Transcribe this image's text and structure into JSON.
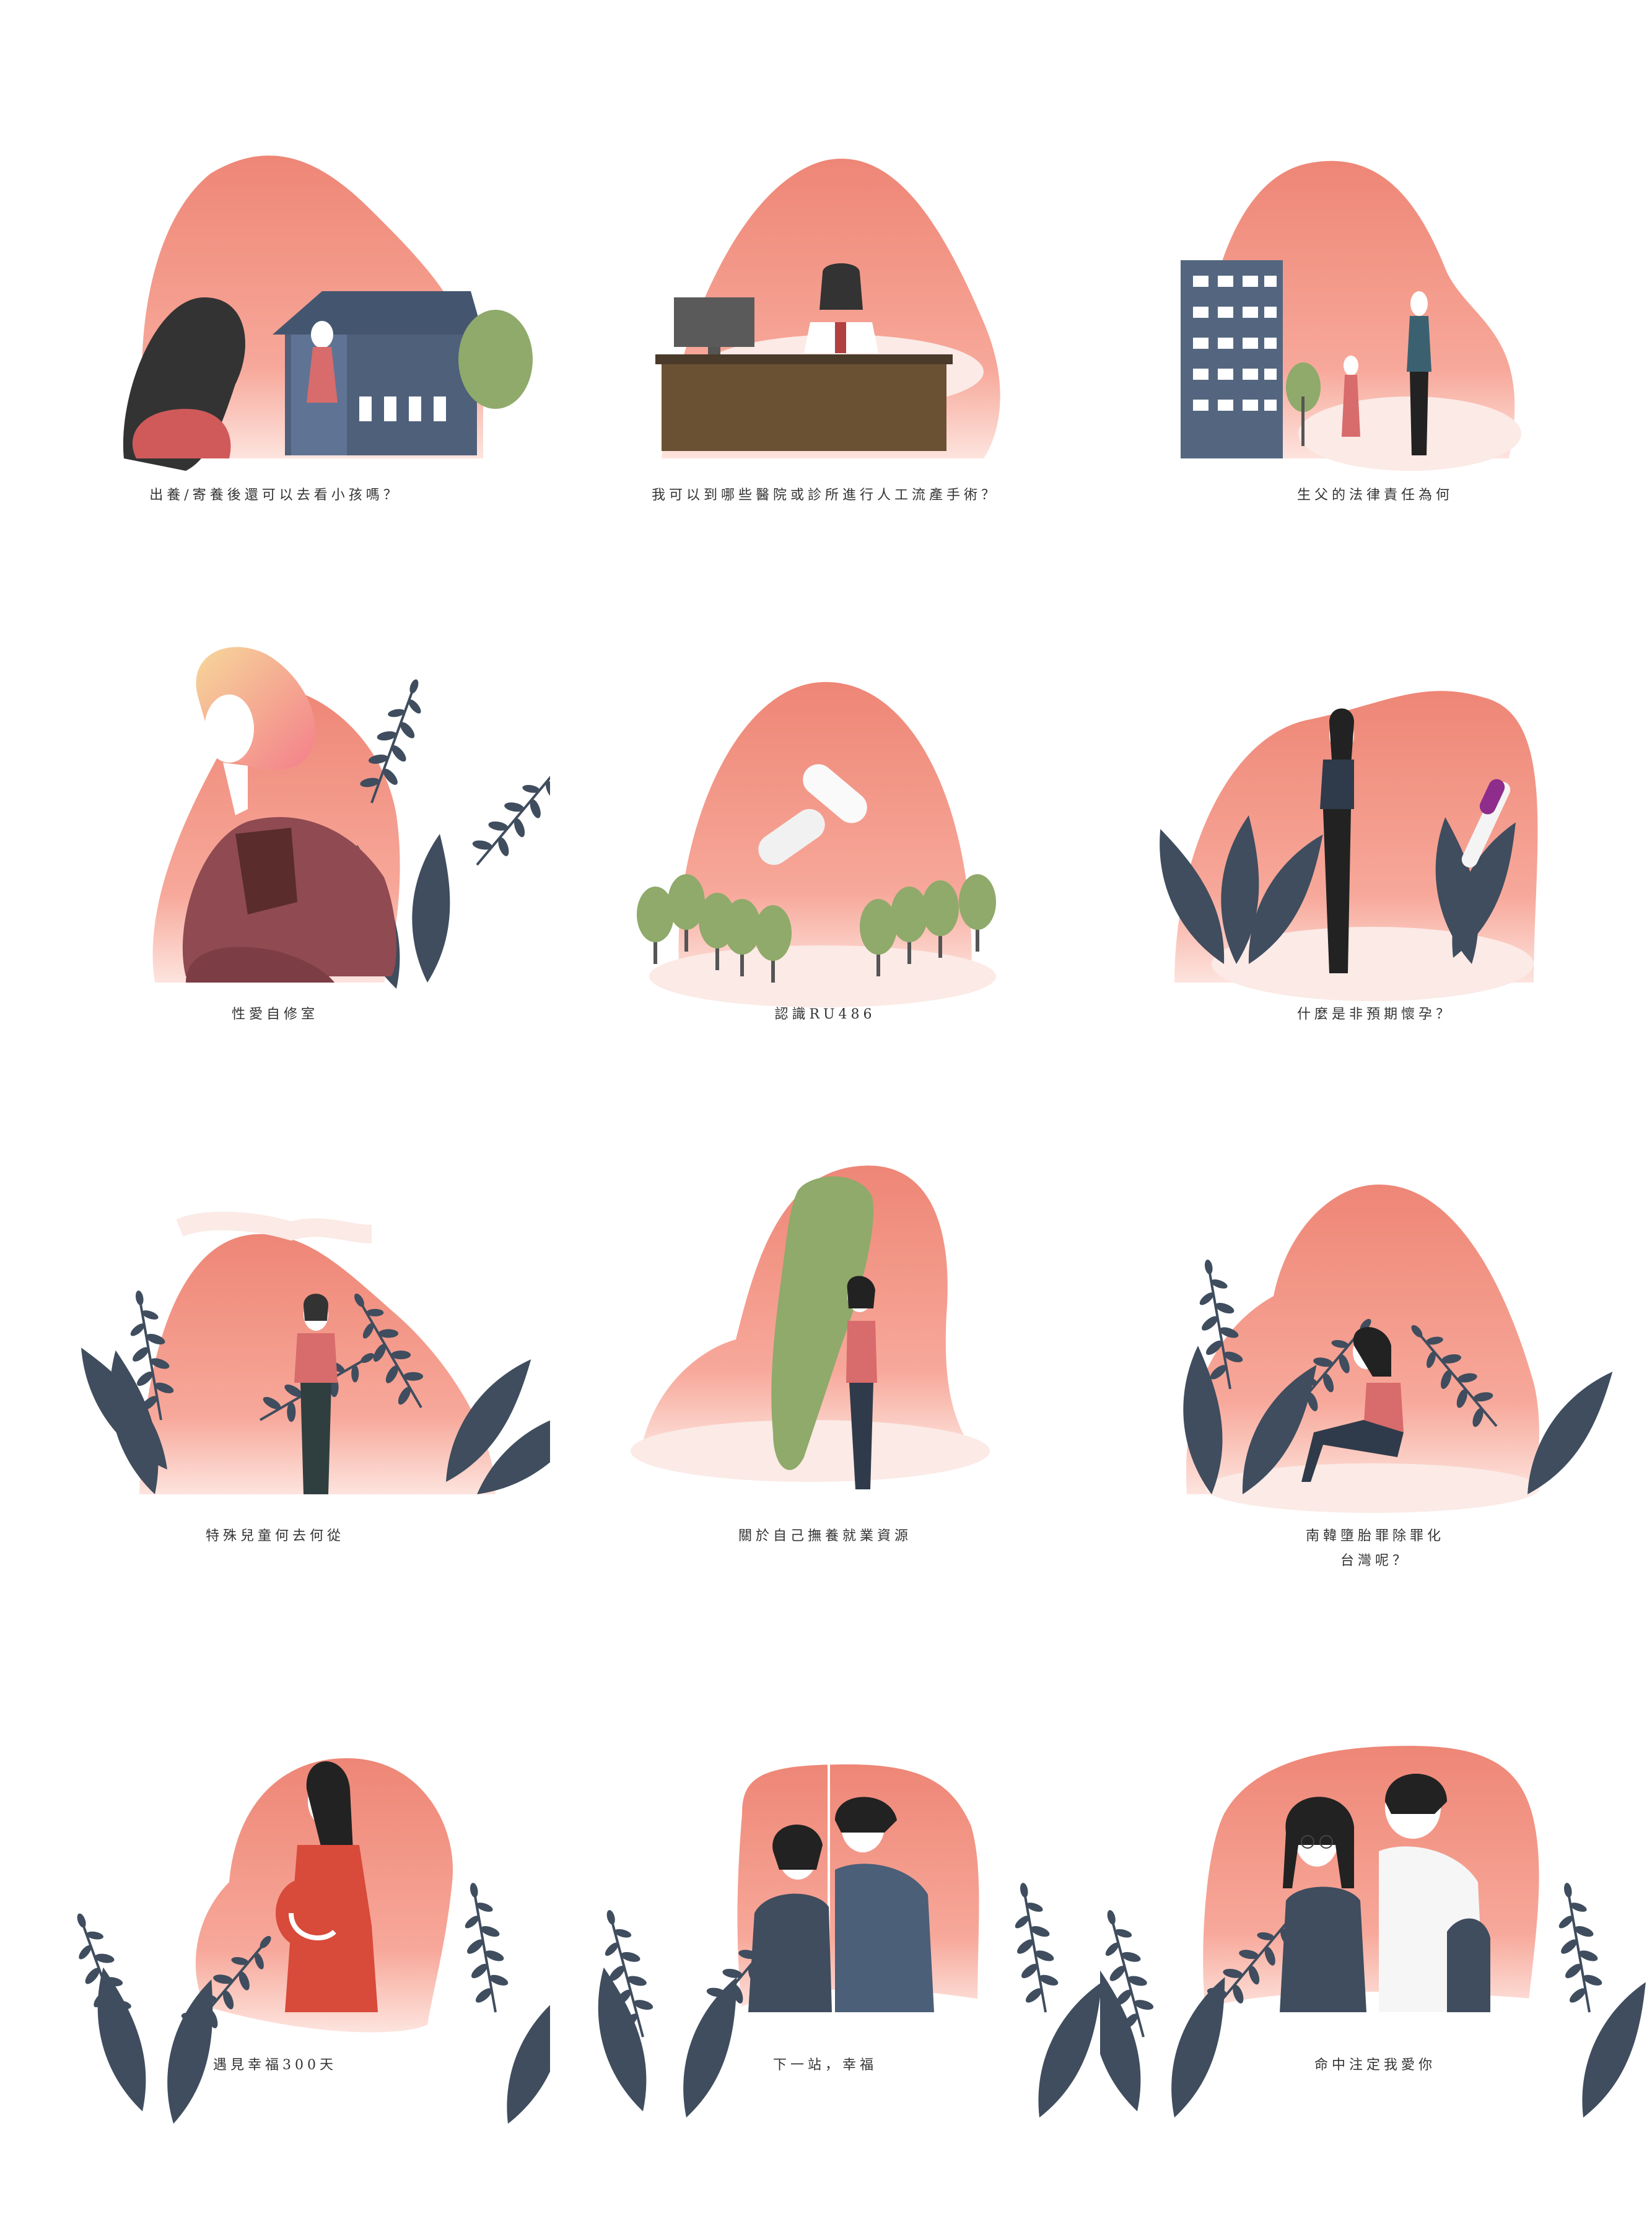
{
  "colors": {
    "blob_top": "#ee8a7a",
    "blob_bottom": "#fbd7cf",
    "navy": "#3f4d5e",
    "leaf_green": "#8faa6a",
    "text": "#333333"
  },
  "cards": [
    {
      "caption": [
        "出養/寄養後還可以去看小孩嗎？"
      ],
      "icon": "adoption-house-illustration"
    },
    {
      "caption": [
        "我可以到哪些醫院或診所進行人工流產手術？"
      ],
      "icon": "clinic-doctor-illustration"
    },
    {
      "caption": [
        "生父的法律責任為何"
      ],
      "icon": "father-building-illustration"
    },
    {
      "caption": [
        "性愛自修室"
      ],
      "icon": "girl-thinking-illustration"
    },
    {
      "caption": [
        "認識RU486"
      ],
      "icon": "pill-illustration"
    },
    {
      "caption": [
        "什麼是非預期懷孕？"
      ],
      "icon": "pregnancy-test-illustration"
    },
    {
      "caption": [
        "特殊兒童何去何從"
      ],
      "icon": "standing-girl-illustration"
    },
    {
      "caption": [
        "關於自己撫養就業資源"
      ],
      "icon": "taiwan-map-illustration"
    },
    {
      "caption": [
        "南韓墮胎罪除罪化",
        "台灣呢？"
      ],
      "icon": "sitting-woman-illustration"
    },
    {
      "caption": [
        "遇見幸福300天"
      ],
      "icon": "pregnant-woman-illustration"
    },
    {
      "caption": [
        "下一站，幸福"
      ],
      "icon": "couple-illustration"
    },
    {
      "caption": [
        "命中注定我愛你"
      ],
      "icon": "couple-glasses-illustration"
    }
  ]
}
